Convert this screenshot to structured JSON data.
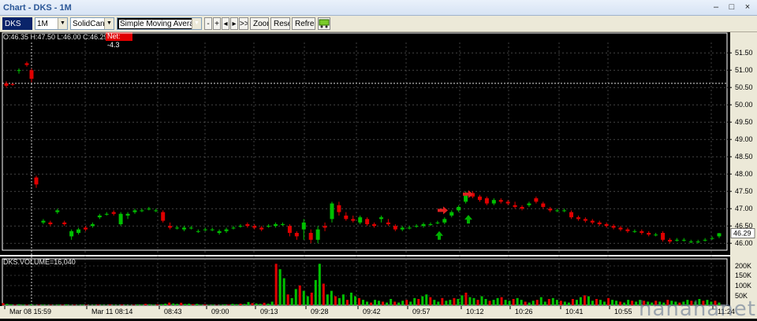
{
  "window": {
    "title": "Chart - DKS - 1M",
    "minimize_glyph": "–",
    "maximize_glyph": "□",
    "close_glyph": "×"
  },
  "toolbar": {
    "symbol": "DKS",
    "interval": "1M",
    "chart_style": "SolidCandle",
    "study": "Simple Moving Average",
    "nav_buttons": [
      "-",
      "+",
      "◂",
      "▸",
      ">>|"
    ],
    "zoom_label": "Zoom",
    "reset_label": "Reset",
    "refresh_label": "Refresh",
    "link_icon": "link-chart-icon"
  },
  "status": {
    "ohlc": "O:46.35  H:47.50  L:46.00  C:46.29",
    "net_change": "Net: -4.3"
  },
  "price_axis": {
    "ticks": [
      "51.50",
      "51.00",
      "50.50",
      "50.00",
      "49.50",
      "49.00",
      "48.50",
      "48.00",
      "47.50",
      "47.00",
      "46.50",
      "46.00"
    ],
    "last_price": "46.29"
  },
  "volume": {
    "label": "DKS.VOLUME=16,040",
    "ticks": [
      "200K",
      "150K",
      "100K",
      "50K"
    ]
  },
  "time_axis": {
    "labels": [
      "Mar 08 15:59",
      "Mar 11 08:14",
      "08:43",
      "09:00",
      "09:13",
      "09:28",
      "09:42",
      "09:57",
      "10:12",
      "10:26",
      "10:41",
      "10:55",
      "11:24"
    ]
  },
  "colors": {
    "up": "#00c000",
    "down": "#e00000",
    "background": "#000000",
    "grid": "#6b6b6b",
    "arrow_buy": "#00b000",
    "arrow_sell": "#e02020"
  },
  "chart_data": {
    "type": "candlestick",
    "symbol": "DKS",
    "interval": "1M",
    "y_range": [
      45.8,
      51.8
    ],
    "y_ticks": [
      46.0,
      46.5,
      47.0,
      47.5,
      48.0,
      48.5,
      49.0,
      49.5,
      50.0,
      50.5,
      51.0,
      51.5
    ],
    "reference_line": 50.62,
    "candles": [
      [
        50.62,
        50.68,
        50.5,
        50.55
      ],
      [
        50.6,
        50.62,
        50.55,
        50.58
      ],
      [
        51.0,
        51.05,
        50.9,
        51.0
      ],
      [
        51.2,
        51.25,
        51.1,
        51.15
      ],
      [
        51.0,
        51.05,
        50.65,
        50.75
      ],
      [
        47.9,
        47.95,
        47.6,
        47.7
      ],
      [
        46.6,
        46.7,
        46.55,
        46.65
      ],
      [
        46.6,
        46.65,
        46.5,
        46.55
      ],
      [
        46.9,
        47.0,
        46.85,
        46.95
      ],
      [
        46.6,
        46.65,
        46.5,
        46.55
      ],
      [
        46.2,
        46.4,
        46.1,
        46.35
      ],
      [
        46.3,
        46.45,
        46.25,
        46.4
      ],
      [
        46.45,
        46.5,
        46.35,
        46.4
      ],
      [
        46.5,
        46.6,
        46.45,
        46.55
      ],
      [
        46.75,
        46.85,
        46.7,
        46.8
      ],
      [
        46.85,
        46.9,
        46.8,
        46.85
      ],
      [
        46.9,
        46.95,
        46.8,
        46.85
      ],
      [
        46.55,
        46.9,
        46.5,
        46.85
      ],
      [
        46.8,
        46.9,
        46.7,
        46.85
      ],
      [
        46.9,
        47.0,
        46.85,
        46.95
      ],
      [
        46.95,
        47.0,
        46.9,
        46.95
      ],
      [
        47.0,
        47.05,
        46.95,
        47.0
      ],
      [
        46.95,
        47.0,
        46.9,
        46.95
      ],
      [
        46.9,
        46.95,
        46.6,
        46.65
      ],
      [
        46.5,
        46.6,
        46.4,
        46.45
      ],
      [
        46.45,
        46.5,
        46.4,
        46.45
      ],
      [
        46.4,
        46.5,
        46.35,
        46.45
      ],
      [
        46.45,
        46.5,
        46.4,
        46.45
      ],
      [
        46.35,
        46.4,
        46.3,
        46.35
      ],
      [
        46.4,
        46.45,
        46.35,
        46.4
      ],
      [
        46.4,
        46.45,
        46.35,
        46.4
      ],
      [
        46.3,
        46.4,
        46.25,
        46.35
      ],
      [
        46.35,
        46.45,
        46.3,
        46.4
      ],
      [
        46.45,
        46.5,
        46.4,
        46.45
      ],
      [
        46.5,
        46.55,
        46.45,
        46.5
      ],
      [
        46.55,
        46.6,
        46.45,
        46.5
      ],
      [
        46.5,
        46.55,
        46.4,
        46.45
      ],
      [
        46.45,
        46.5,
        46.35,
        46.4
      ],
      [
        46.5,
        46.55,
        46.45,
        46.5
      ],
      [
        46.5,
        46.6,
        46.45,
        46.55
      ],
      [
        46.55,
        46.6,
        46.5,
        46.55
      ],
      [
        46.5,
        46.55,
        46.2,
        46.3
      ],
      [
        46.3,
        46.35,
        46.1,
        46.2
      ],
      [
        46.4,
        46.7,
        46.1,
        46.6
      ],
      [
        46.3,
        46.4,
        46.0,
        46.1
      ],
      [
        46.1,
        46.5,
        46.0,
        46.4
      ],
      [
        46.5,
        46.6,
        46.35,
        46.45
      ],
      [
        46.7,
        47.2,
        46.6,
        47.15
      ],
      [
        47.1,
        47.2,
        46.8,
        46.9
      ],
      [
        46.8,
        46.9,
        46.65,
        46.7
      ],
      [
        46.7,
        46.8,
        46.6,
        46.65
      ],
      [
        46.6,
        46.8,
        46.55,
        46.75
      ],
      [
        46.7,
        46.75,
        46.5,
        46.55
      ],
      [
        46.55,
        46.6,
        46.45,
        46.5
      ],
      [
        46.7,
        46.8,
        46.6,
        46.75
      ],
      [
        46.6,
        46.7,
        46.5,
        46.55
      ],
      [
        46.5,
        46.55,
        46.35,
        46.4
      ],
      [
        46.4,
        46.5,
        46.35,
        46.45
      ],
      [
        46.45,
        46.5,
        46.4,
        46.45
      ],
      [
        46.5,
        46.55,
        46.45,
        46.5
      ],
      [
        46.5,
        46.6,
        46.45,
        46.55
      ],
      [
        46.55,
        46.6,
        46.5,
        46.55
      ],
      [
        46.6,
        46.65,
        46.55,
        46.6
      ],
      [
        46.6,
        46.75,
        46.55,
        46.7
      ],
      [
        46.8,
        46.95,
        46.75,
        46.9
      ],
      [
        46.95,
        47.1,
        46.9,
        47.05
      ],
      [
        47.2,
        47.5,
        47.15,
        47.45
      ],
      [
        47.45,
        47.5,
        47.3,
        47.35
      ],
      [
        47.35,
        47.4,
        47.2,
        47.25
      ],
      [
        47.3,
        47.35,
        47.1,
        47.15
      ],
      [
        47.15,
        47.3,
        47.1,
        47.25
      ],
      [
        47.25,
        47.3,
        47.15,
        47.2
      ],
      [
        47.2,
        47.25,
        47.1,
        47.15
      ],
      [
        47.1,
        47.2,
        47.0,
        47.05
      ],
      [
        47.05,
        47.1,
        46.95,
        47.0
      ],
      [
        47.1,
        47.2,
        47.05,
        47.15
      ],
      [
        47.3,
        47.35,
        47.15,
        47.2
      ],
      [
        47.15,
        47.2,
        47.0,
        47.05
      ],
      [
        47.0,
        47.05,
        46.9,
        46.95
      ],
      [
        46.95,
        47.0,
        46.9,
        46.95
      ],
      [
        46.95,
        47.0,
        46.9,
        46.95
      ],
      [
        46.9,
        46.95,
        46.7,
        46.75
      ],
      [
        46.75,
        46.8,
        46.65,
        46.7
      ],
      [
        46.7,
        46.75,
        46.6,
        46.65
      ],
      [
        46.65,
        46.7,
        46.55,
        46.6
      ],
      [
        46.6,
        46.65,
        46.5,
        46.55
      ],
      [
        46.55,
        46.6,
        46.45,
        46.5
      ],
      [
        46.5,
        46.55,
        46.4,
        46.45
      ],
      [
        46.45,
        46.5,
        46.35,
        46.4
      ],
      [
        46.4,
        46.45,
        46.3,
        46.35
      ],
      [
        46.35,
        46.4,
        46.3,
        46.35
      ],
      [
        46.35,
        46.4,
        46.25,
        46.3
      ],
      [
        46.3,
        46.35,
        46.2,
        46.25
      ],
      [
        46.25,
        46.3,
        46.2,
        46.25
      ],
      [
        46.3,
        46.35,
        46.05,
        46.1
      ],
      [
        46.1,
        46.15,
        46.0,
        46.05
      ],
      [
        46.1,
        46.15,
        46.05,
        46.1
      ],
      [
        46.1,
        46.15,
        46.05,
        46.1
      ],
      [
        46.05,
        46.1,
        46.0,
        46.05
      ],
      [
        46.05,
        46.1,
        46.0,
        46.05
      ],
      [
        46.1,
        46.15,
        46.05,
        46.1
      ],
      [
        46.15,
        46.2,
        46.1,
        46.15
      ],
      [
        46.2,
        46.3,
        46.15,
        46.29
      ]
    ],
    "volume": [
      12,
      8,
      5,
      3,
      6,
      4,
      3,
      5,
      2,
      3,
      4,
      2,
      3,
      2,
      4,
      3,
      5,
      2,
      3,
      2,
      4,
      3,
      2,
      3,
      4,
      3,
      2,
      5,
      3,
      2,
      4,
      3,
      2,
      3,
      5,
      4,
      8,
      6,
      4,
      5,
      6,
      9,
      15,
      10,
      8,
      14,
      7,
      9,
      6,
      8,
      4,
      5,
      3,
      4,
      2,
      3,
      5,
      4,
      8,
      6,
      9,
      7,
      18,
      12,
      10,
      8,
      14,
      9,
      20,
      230,
      200,
      150,
      60,
      40,
      90,
      110,
      80,
      50,
      70,
      140,
      230,
      120,
      60,
      80,
      50,
      40,
      60,
      30,
      70,
      50,
      40,
      30,
      20,
      15,
      30,
      25,
      20,
      15,
      35,
      20,
      15,
      25,
      30,
      20,
      40,
      35,
      50,
      60,
      45,
      30,
      20,
      40,
      25,
      30,
      40,
      35,
      55,
      70,
      45,
      40,
      30,
      50,
      35,
      25,
      30,
      40,
      45,
      30,
      25,
      35,
      40,
      30,
      20,
      15,
      25,
      30,
      45,
      20,
      35,
      40,
      30,
      25,
      20,
      15,
      35,
      30,
      45,
      55,
      50,
      25,
      35,
      30,
      20,
      40,
      30,
      25,
      20,
      15,
      30,
      25,
      20,
      30,
      25,
      20,
      15,
      25,
      20,
      15,
      30,
      25,
      20,
      15,
      20,
      30,
      25,
      20,
      35,
      25,
      30,
      20,
      25,
      15
    ]
  }
}
